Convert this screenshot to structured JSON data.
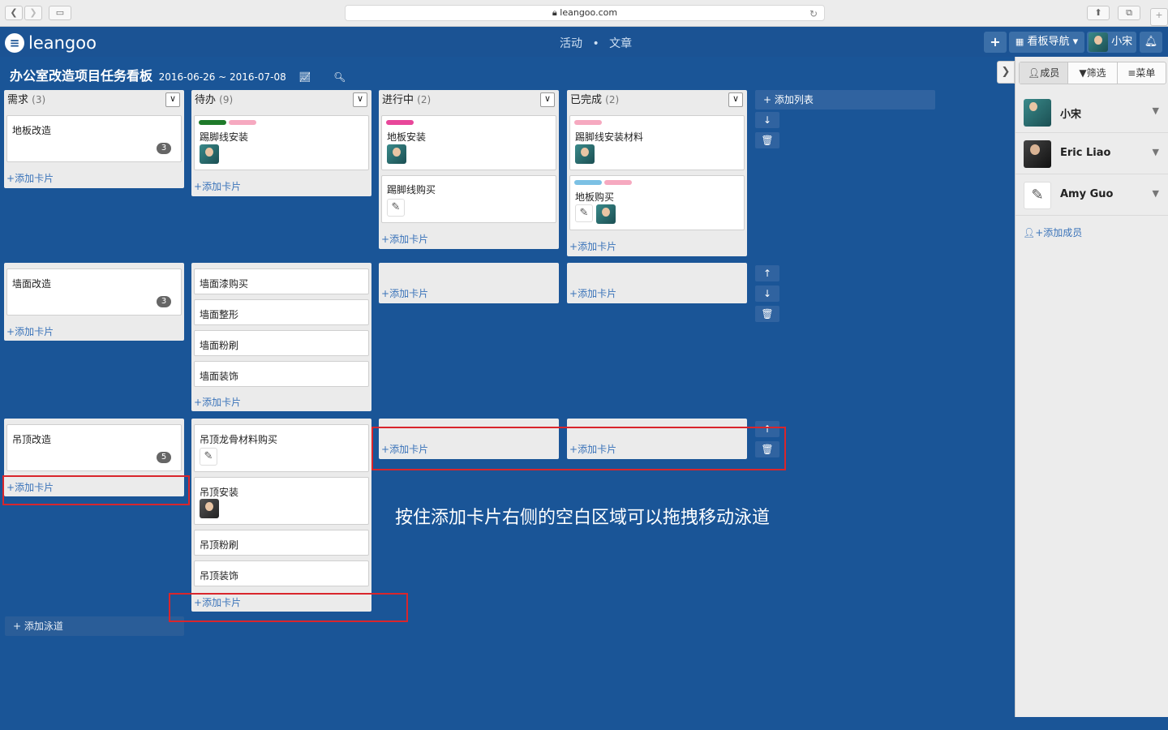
{
  "browser": {
    "url": "leangoo.com"
  },
  "app": {
    "logo": "leangoo",
    "nav": {
      "activity": "活动",
      "sep": "•",
      "articles": "文章"
    },
    "header": {
      "add": "+",
      "board_nav": "看板导航 ▾",
      "user": "小宋",
      "bell": "🔔"
    }
  },
  "board": {
    "title": "办公室改造项目任务看板",
    "dates": "2016-06-26 ~ 2016-07-08"
  },
  "columns": [
    {
      "name": "需求",
      "count": "(3)"
    },
    {
      "name": "待办",
      "count": "(9)"
    },
    {
      "name": "进行中",
      "count": "(2)"
    },
    {
      "name": "已完成",
      "count": "(2)"
    }
  ],
  "add_card": "添加卡片",
  "add_list": "添加列表",
  "add_lane": "添加泳道",
  "cards": {
    "lane1": {
      "req": {
        "title": "地板改造",
        "badge": "3"
      },
      "todo": {
        "title": "踢脚线安装"
      },
      "doing1": {
        "title": "地板安装"
      },
      "doing2": {
        "title": "踢脚线购买"
      },
      "done1": {
        "title": "踢脚线安装材料"
      },
      "done2": {
        "title": "地板购买"
      }
    },
    "lane2": {
      "req": {
        "title": "墙面改造",
        "badge": "3"
      },
      "todo": [
        "墙面漆购买",
        "墙面整形",
        "墙面粉刷",
        "墙面装饰"
      ]
    },
    "lane3": {
      "req": {
        "title": "吊顶改造",
        "badge": "5"
      },
      "todo1": {
        "title": "吊顶龙骨材料购买"
      },
      "todo2": {
        "title": "吊顶安装"
      },
      "todo3": {
        "title": "吊顶粉刷"
      },
      "todo4": {
        "title": "吊顶装饰"
      }
    }
  },
  "label_colors": {
    "green": "#1f7a2a",
    "pink": "#f6a9c0",
    "magenta": "#e8479a",
    "blue": "#7cc1e4"
  },
  "sidebar": {
    "tabs": [
      "成员",
      "筛选",
      "菜单"
    ],
    "members": [
      "小宋",
      "Eric Liao",
      "Amy Guo"
    ],
    "add_member": "添加成员"
  },
  "annotation": "按住添加卡片右侧的空白区域可以拖拽移动泳道"
}
